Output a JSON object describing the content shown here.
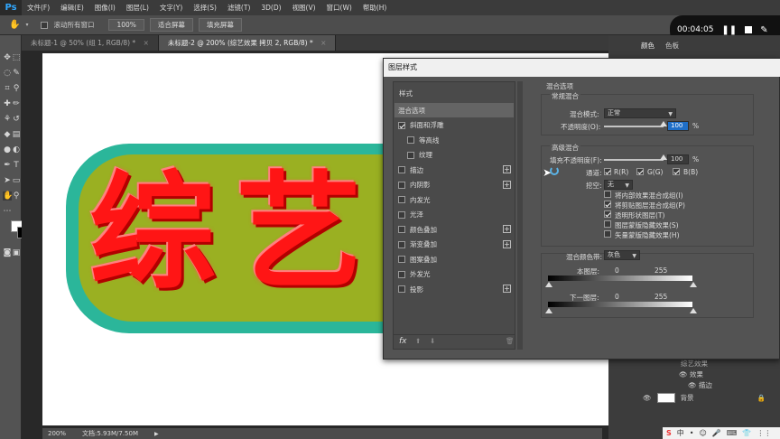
{
  "app": {
    "logo": "Ps"
  },
  "menu": [
    "文件(F)",
    "编辑(E)",
    "图像(I)",
    "图层(L)",
    "文字(Y)",
    "选择(S)",
    "滤镜(T)",
    "3D(D)",
    "视图(V)",
    "窗口(W)",
    "帮助(H)"
  ],
  "options": {
    "scroll_all_label": "滚动所有窗口",
    "zoom_value": "100%",
    "fit_screen": "适合屏幕",
    "fill_screen": "填充屏幕"
  },
  "tabs": [
    {
      "label": "未标题-1 @ 50% (组 1, RGB/8) *",
      "close": "×"
    },
    {
      "label": "未标题-2 @ 200% (综艺效果 拷贝 2, RGB/8) *",
      "close": "×"
    }
  ],
  "canvas": {
    "text": "综艺"
  },
  "status": {
    "zoom": "200%",
    "doc": "文档:5.93M/7.50M"
  },
  "recording": {
    "time": "00:04:05"
  },
  "right_panel": {
    "tab_color": "颜色",
    "tab_swatch": "色板",
    "button_new": "新",
    "layers": [
      {
        "name": "综艺效果"
      },
      {
        "name": "效果"
      },
      {
        "name": "描边"
      },
      {
        "name": "背景"
      }
    ]
  },
  "dialog": {
    "title": "图层样式",
    "styles_header": "样式",
    "styles": [
      {
        "label": "混合选项",
        "has_checkbox": false,
        "checked": false,
        "plus": false,
        "selected": true
      },
      {
        "label": "斜面和浮雕",
        "has_checkbox": true,
        "checked": true,
        "plus": false,
        "selected": false
      },
      {
        "label": "等高线",
        "has_checkbox": true,
        "checked": false,
        "plus": false,
        "selected": false,
        "indent": true
      },
      {
        "label": "纹理",
        "has_checkbox": true,
        "checked": false,
        "plus": false,
        "selected": false,
        "indent": true
      },
      {
        "label": "描边",
        "has_checkbox": true,
        "checked": false,
        "plus": true,
        "selected": false
      },
      {
        "label": "内阴影",
        "has_checkbox": true,
        "checked": false,
        "plus": true,
        "selected": false
      },
      {
        "label": "内发光",
        "has_checkbox": true,
        "checked": false,
        "plus": false,
        "selected": false
      },
      {
        "label": "光泽",
        "has_checkbox": true,
        "checked": false,
        "plus": false,
        "selected": false
      },
      {
        "label": "颜色叠加",
        "has_checkbox": true,
        "checked": false,
        "plus": true,
        "selected": false
      },
      {
        "label": "渐变叠加",
        "has_checkbox": true,
        "checked": false,
        "plus": true,
        "selected": false
      },
      {
        "label": "图案叠加",
        "has_checkbox": true,
        "checked": false,
        "plus": false,
        "selected": false
      },
      {
        "label": "外发光",
        "has_checkbox": true,
        "checked": false,
        "plus": false,
        "selected": false
      },
      {
        "label": "投影",
        "has_checkbox": true,
        "checked": false,
        "plus": true,
        "selected": false
      }
    ],
    "fx_label": "fx",
    "blend_options_title": "混合选项",
    "general_title": "常规混合",
    "blend_mode_label": "混合模式:",
    "blend_mode_value": "正常",
    "opacity_label": "不透明度(O):",
    "opacity_value": "100",
    "opacity_fraction": 1.0,
    "percent": "%",
    "advanced_title": "高级混合",
    "fill_opacity_label": "填充不透明度(F):",
    "fill_opacity_value": "100",
    "fill_fraction": 1.0,
    "channels_label": "通道:",
    "channel_r": "R(R)",
    "channel_g": "G(G)",
    "channel_b": "B(B)",
    "knockout_label": "挖空:",
    "knockout_value": "无",
    "options": [
      {
        "label": "将内部效果混合成组(I)",
        "checked": false
      },
      {
        "label": "将剪贴图层混合成组(P)",
        "checked": true
      },
      {
        "label": "透明形状图层(T)",
        "checked": true
      },
      {
        "label": "图层蒙版隐藏效果(S)",
        "checked": false
      },
      {
        "label": "矢量蒙版隐藏效果(H)",
        "checked": false
      }
    ],
    "blend_if_label": "混合颜色带:",
    "blend_if_value": "灰色",
    "this_layer_label": "本图层:",
    "underlying_label": "下一图层:",
    "range_low": "0",
    "range_high": "255"
  }
}
